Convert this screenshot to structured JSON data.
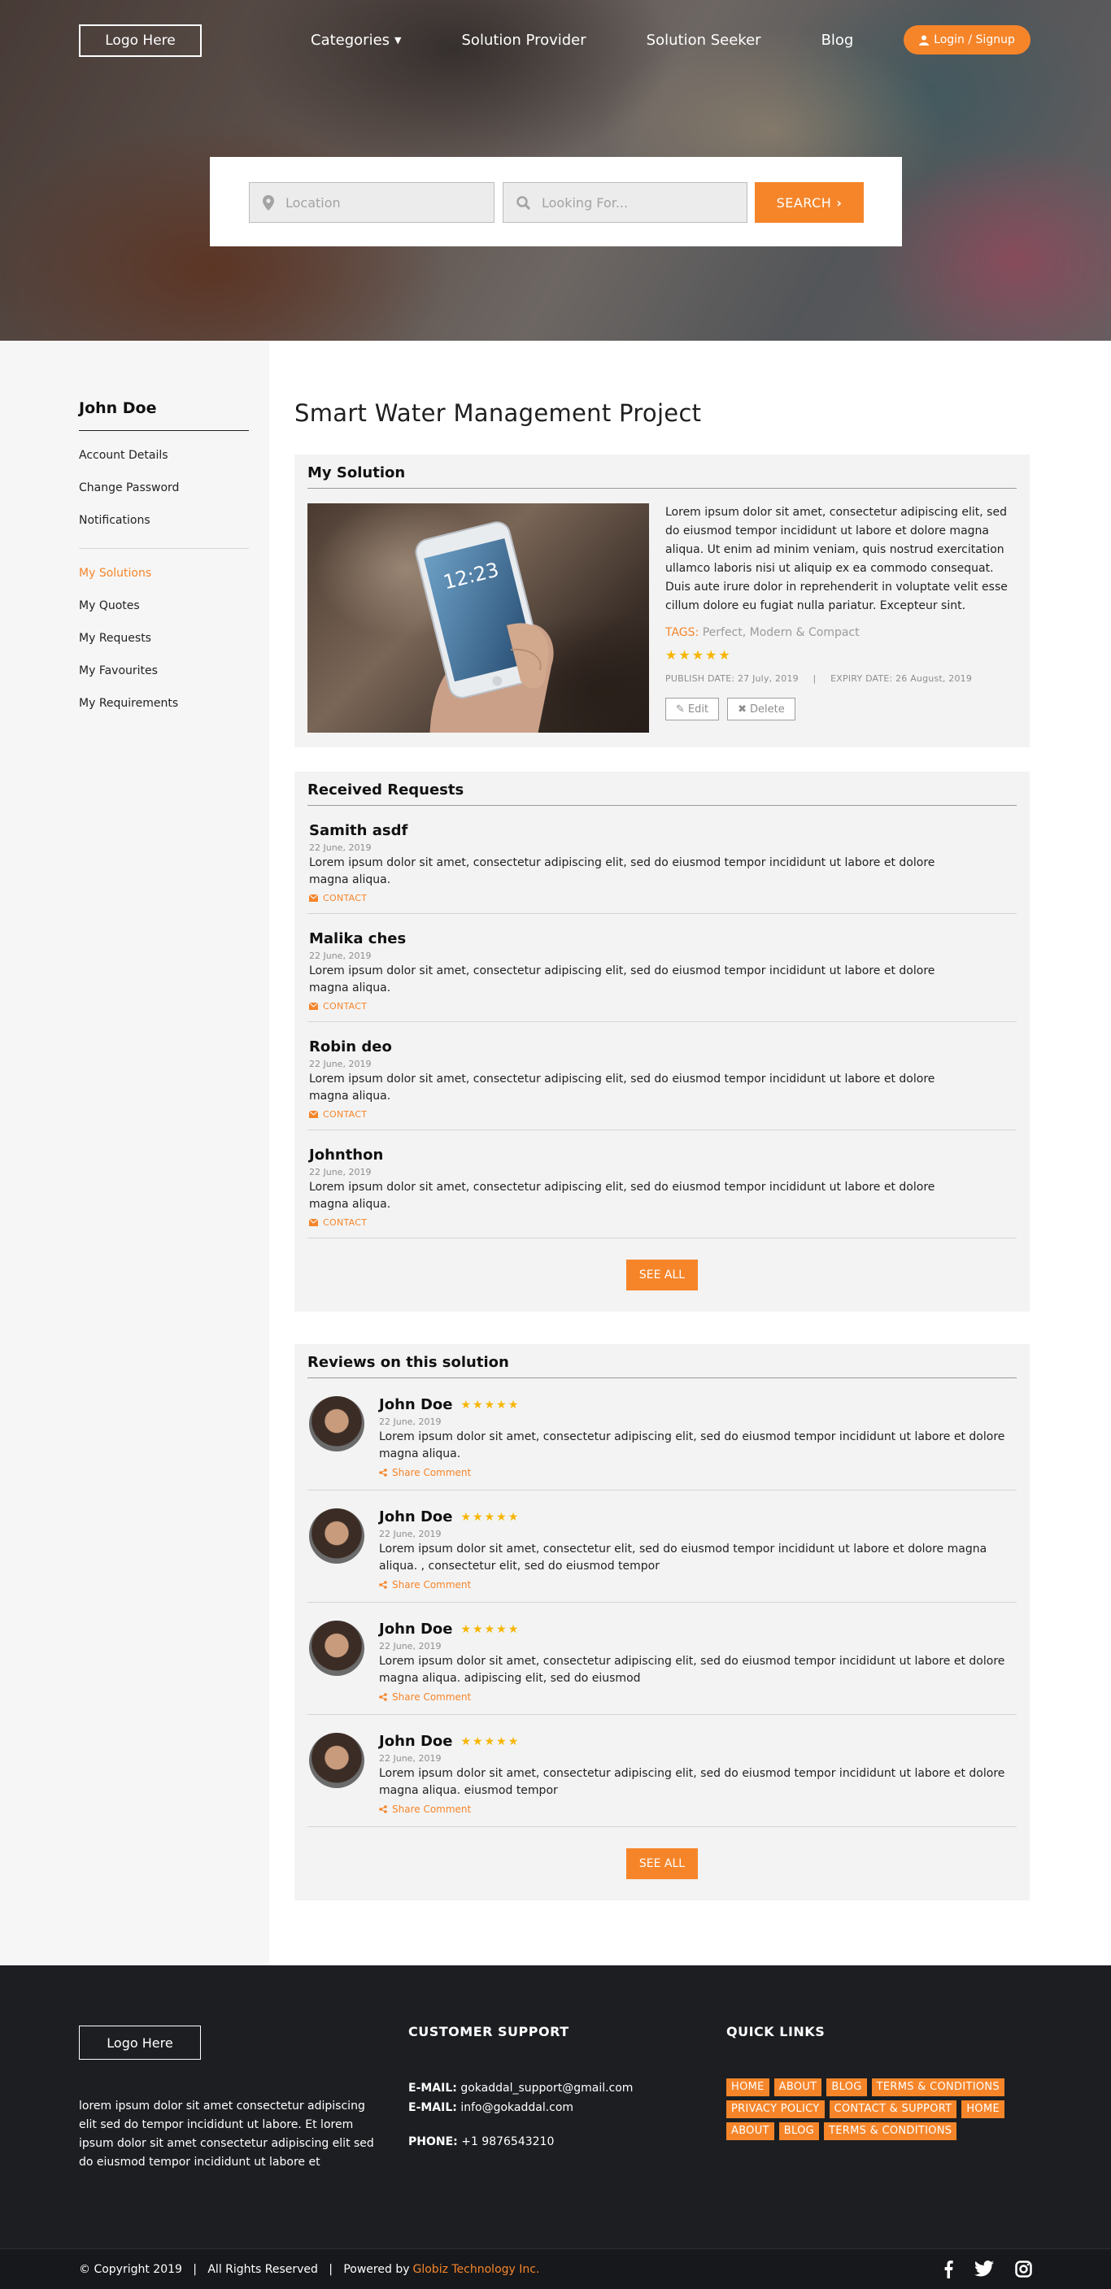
{
  "header": {
    "logo": "Logo Here",
    "nav": [
      "Categories",
      "Solution Provider",
      "Solution Seeker",
      "Blog"
    ],
    "login": "Login / Signup"
  },
  "search": {
    "location_placeholder": "Location",
    "looking_placeholder": "Looking For...",
    "button": "SEARCH"
  },
  "sidebar": {
    "user": "John Doe",
    "account_items": [
      "Account Details",
      "Change Password",
      "Notifications"
    ],
    "solution_items": [
      "My Solutions",
      "My Quotes",
      "My Requests",
      "My Favourites",
      "My Requirements"
    ],
    "active": "My Solutions"
  },
  "page": {
    "title": "Smart Water Management Project"
  },
  "solution": {
    "heading": "My Solution",
    "description": "Lorem ipsum dolor sit amet, consectetur adipiscing elit, sed do eiusmod tempor incididunt ut labore et dolore magna aliqua. Ut enim ad minim veniam, quis nostrud exercitation ullamco laboris nisi ut aliquip ex ea commodo consequat. Duis aute irure dolor in reprehenderit in voluptate velit esse cillum dolore eu fugiat nulla pariatur. Excepteur sint.",
    "tags_label": "TAGS:",
    "tags": "Perfect, Modern & Compact",
    "rating": "★★★★★",
    "publish": "PUBLISH DATE: 27 July, 2019",
    "separator": "|",
    "expiry": "EXPIRY DATE: 26 August, 2019",
    "edit": "Edit",
    "delete": "Delete",
    "phone_time": "12:23"
  },
  "requests": {
    "heading": "Received Requests",
    "contact_label": "CONTACT",
    "see_all": "SEE ALL",
    "items": [
      {
        "name": "Samith asdf",
        "date": "22 June, 2019",
        "text": "Lorem ipsum dolor sit amet, consectetur adipiscing elit, sed do eiusmod tempor incididunt ut labore et dolore magna aliqua."
      },
      {
        "name": "Malika ches",
        "date": "22 June, 2019",
        "text": "Lorem ipsum dolor sit amet, consectetur adipiscing elit, sed do eiusmod tempor incididunt ut labore et dolore magna aliqua."
      },
      {
        "name": "Robin deo",
        "date": "22 June, 2019",
        "text": "Lorem ipsum dolor sit amet, consectetur adipiscing elit, sed do eiusmod tempor incididunt ut labore et dolore magna aliqua."
      },
      {
        "name": "Johnthon",
        "date": "22 June, 2019",
        "text": "Lorem ipsum dolor sit amet, consectetur adipiscing elit, sed do eiusmod tempor incididunt ut labore et dolore magna aliqua."
      }
    ]
  },
  "reviews": {
    "heading": "Reviews on this solution",
    "share_label": "Share Comment",
    "see_all": "SEE ALL",
    "items": [
      {
        "name": "John Doe",
        "rating": "★★★★★",
        "date": "22 June, 2019",
        "text": "Lorem ipsum dolor sit amet, consectetur adipiscing elit, sed do eiusmod tempor incididunt ut labore et dolore magna aliqua."
      },
      {
        "name": "John Doe",
        "rating": "★★★★★",
        "date": "22 June, 2019",
        "text": "Lorem ipsum dolor sit amet, consectetur elit, sed do eiusmod tempor incididunt ut labore et dolore magna aliqua. , consectetur elit, sed do eiusmod tempor"
      },
      {
        "name": "John Doe",
        "rating": "★★★★★",
        "date": "22 June, 2019",
        "text": "Lorem ipsum dolor sit amet, consectetur adipiscing elit, sed do eiusmod tempor incididunt ut labore et dolore magna aliqua. adipiscing elit, sed do eiusmod"
      },
      {
        "name": "John Doe",
        "rating": "★★★★★",
        "date": "22 June, 2019",
        "text": "Lorem ipsum dolor sit amet, consectetur adipiscing elit, sed do eiusmod tempor incididunt ut labore et dolore magna aliqua. eiusmod tempor"
      }
    ]
  },
  "footer": {
    "logo": "Logo Here",
    "about": "lorem ipsum dolor sit amet consectetur adipiscing elit sed do tempor incididunt ut labore.  Et lorem ipsum dolor sit amet consectetur adipiscing elit sed do eiusmod tempor incididunt ut labore et",
    "support_heading": "CUSTOMER SUPPORT",
    "email_label": "E-MAIL:",
    "email1": "gokaddal_support@gmail.com",
    "email2": "info@gokaddal.com",
    "phone_label": "PHONE:",
    "phone": "+1 9876543210",
    "links_heading": "QUICK LINKS",
    "links": [
      "HOME",
      "ABOUT",
      "BLOG",
      "TERMS & CONDITIONS",
      "PRIVACY POLICY",
      "CONTACT & SUPPORT",
      "HOME",
      "ABOUT",
      "BLOG",
      "TERMS & CONDITIONS"
    ],
    "copyright": "© Copyright 2019   |   All Rights Reserved   |   Powered by",
    "powered": "Globiz Technology Inc."
  },
  "colors": {
    "accent": "#f6852a",
    "star": "#f7b500",
    "footer_bg": "#1c1e21"
  }
}
